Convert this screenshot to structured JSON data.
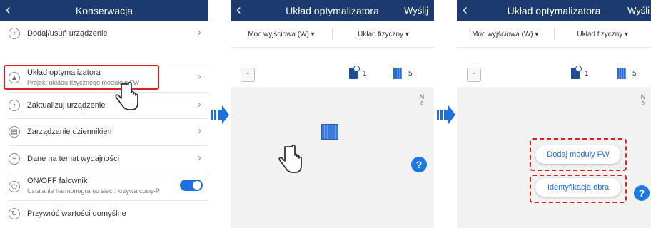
{
  "screen1": {
    "title": "Konserwacja",
    "menu": [
      {
        "icon": "plus-icon",
        "glyph": "+",
        "label": "Dodaj/usuń urządzenie",
        "sub": ""
      },
      {
        "icon": "optimizer-layout-icon",
        "glyph": "▲",
        "label": "Układ optymalizatora",
        "sub": "Projekt układu fizycznego modułów FW"
      },
      {
        "icon": "upgrade-icon",
        "glyph": "↑",
        "label": "Zaktualizuj urządzenie",
        "sub": ""
      },
      {
        "icon": "log-icon",
        "glyph": "▤",
        "label": "Zarządzanie dziennikiem",
        "sub": ""
      },
      {
        "icon": "performance-icon",
        "glyph": "≡",
        "label": "Dane na temat wydajności",
        "sub": ""
      },
      {
        "icon": "power-icon",
        "glyph": "⏻",
        "label": "ON/OFF falownik",
        "sub": "Ustalanie harmonogramu sieci: krzywa cosφ-P"
      },
      {
        "icon": "restore-icon",
        "glyph": "↻",
        "label": "Przywróć wartości domyślne",
        "sub": ""
      }
    ],
    "toggle_on": true
  },
  "screen2": {
    "title": "Układ optymalizatora",
    "send": "Wyślij",
    "filter_power": "Moc wyjściowa (W) ▾",
    "filter_layout": "Układ fizyczny ▾",
    "inverter_count": "1",
    "module_count": "5",
    "north": "N",
    "help": "?"
  },
  "screen3": {
    "title": "Układ optymalizatora",
    "send": "Wyśli",
    "filter_power": "Moc wyjściowa (W) ▾",
    "filter_layout": "Układ fizyczny ▾",
    "inverter_count": "1",
    "module_count": "5",
    "north": "N",
    "add_modules": "Dodaj moduły FW",
    "identify": "Identyfikacja obra",
    "help": "?"
  },
  "colors": {
    "header": "#1c3a6e",
    "accent": "#1f6fde",
    "highlight": "#e02020"
  }
}
